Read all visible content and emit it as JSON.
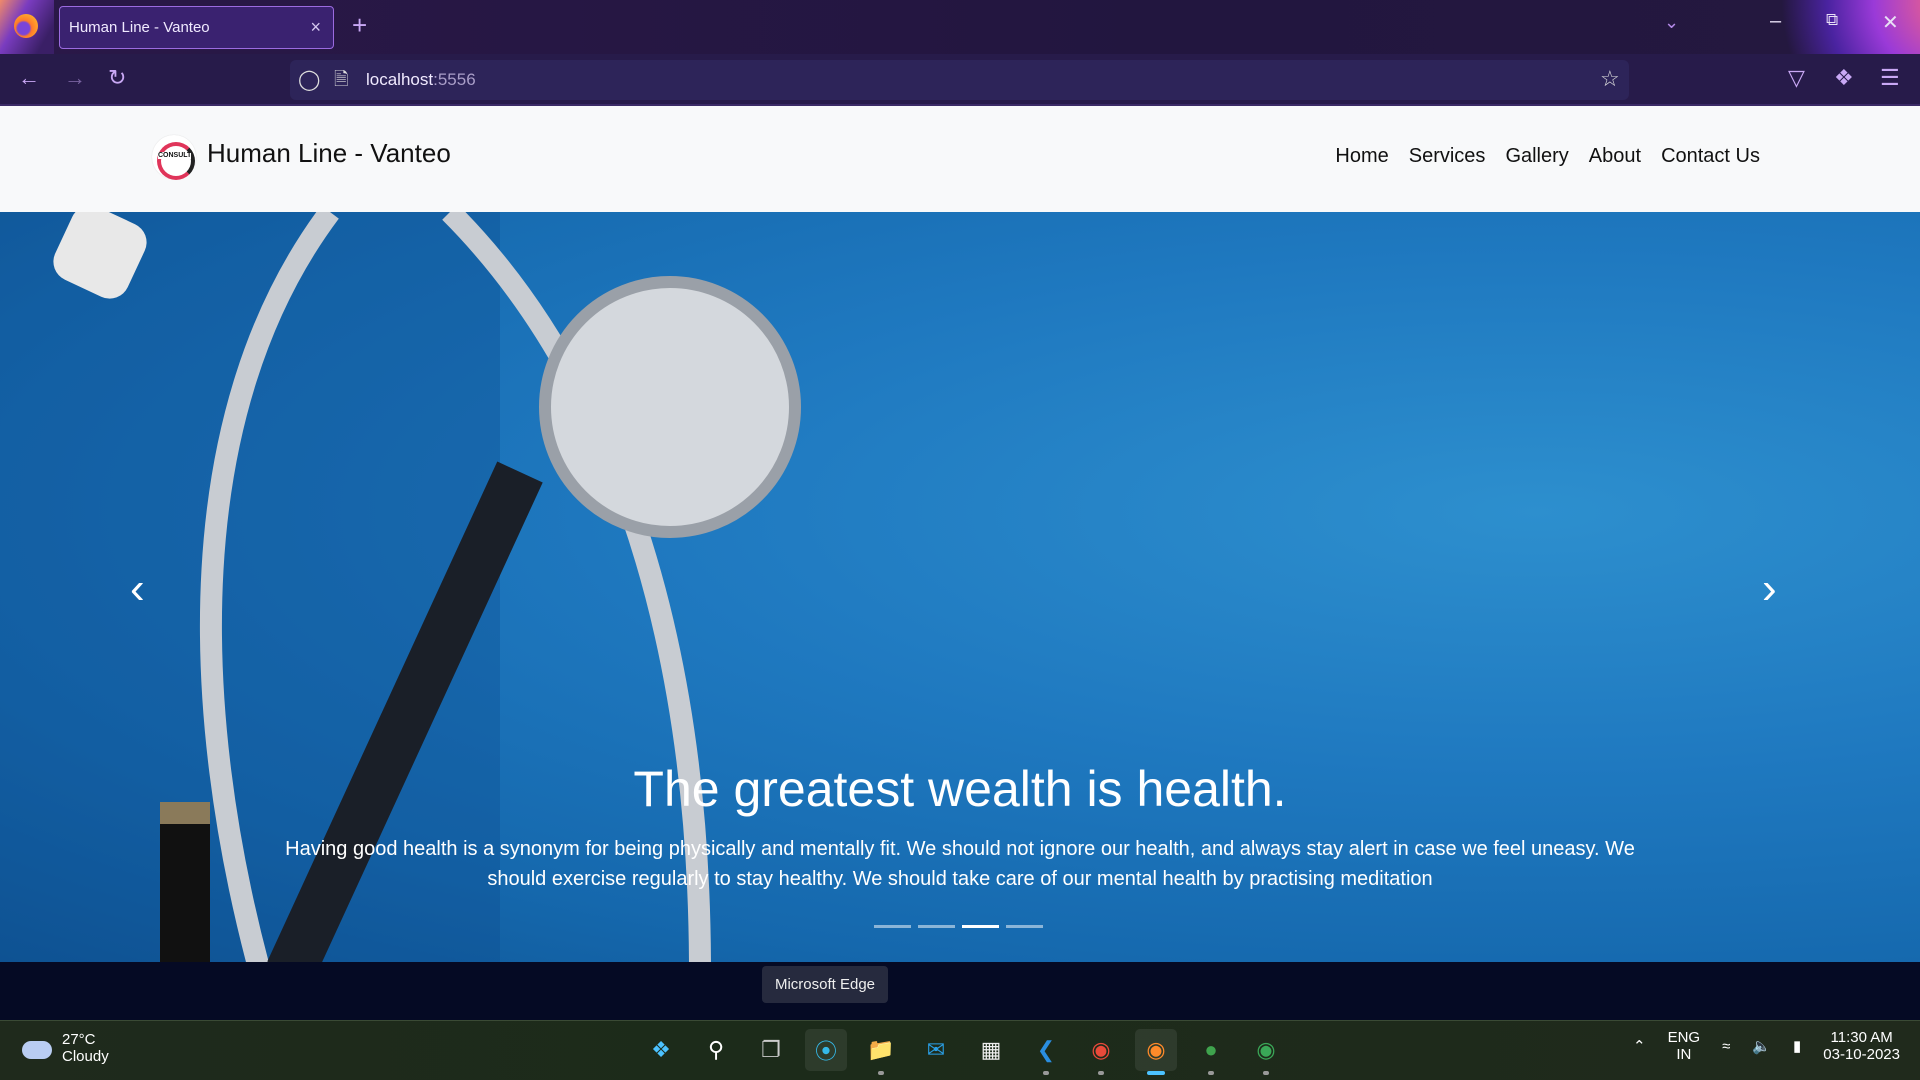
{
  "browser": {
    "tab_title": "Human Line - Vanteo",
    "url_host": "localhost",
    "url_port": ":5556",
    "new_tab": "+",
    "close_tab": "×"
  },
  "site": {
    "brand": "Human Line - Vanteo",
    "logo_text": "CONSULT",
    "nav": [
      "Home",
      "Services",
      "Gallery",
      "About",
      "Contact Us"
    ]
  },
  "hero": {
    "heading": "The greatest wealth is health.",
    "text": "Having good health is a synonym for being physically and mentally fit. We should not ignore our health, and always stay alert in case we feel uneasy. We should exercise regularly to stay healthy. We should take care of our mental health by practising meditation",
    "slides": 4,
    "active_slide": 3
  },
  "tooltip": "Microsoft Edge",
  "taskbar": {
    "temp": "27°C",
    "condition": "Cloudy",
    "lang": "ENG",
    "region": "IN",
    "time": "11:30 AM",
    "date": "03-10-2023"
  }
}
